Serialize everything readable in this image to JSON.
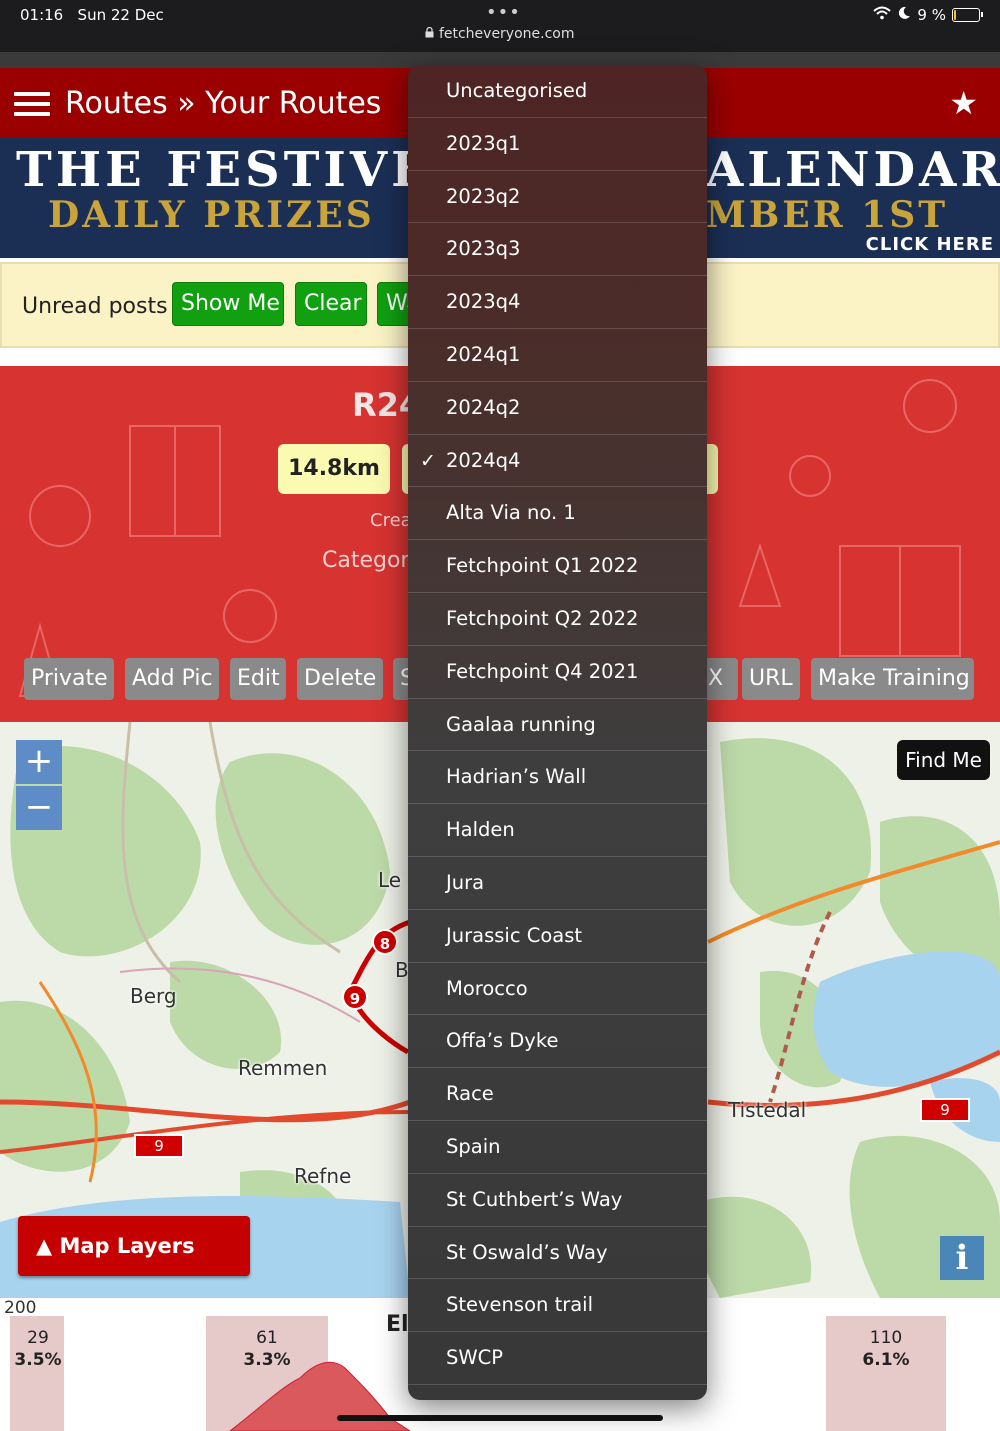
{
  "status_bar": {
    "time": "01:16",
    "date": "Sun 22 Dec",
    "dots": "•••",
    "url": "fetcheveryone.com",
    "battery": "9 %",
    "battery_level": 0.09,
    "wifi_icon": "wifi-icon",
    "moon_icon": "moon-icon"
  },
  "header": {
    "title": "Routes » Your Routes",
    "menu_icon": "hamburger-menu-icon",
    "star_icon": "star-icon"
  },
  "banner": {
    "line1_left": "THE FESTIVE",
    "line1_right": "ALENDAR",
    "line2_left": "DAILY PRIZES",
    "line2_right": "MBER 1ST",
    "click": "CLICK HERE"
  },
  "unread": {
    "label": "Unread posts",
    "show_me": "Show Me",
    "clear": "Clear",
    "third": "Wa"
  },
  "route": {
    "title": "R24",
    "distance": "14.8km",
    "created": "Crea",
    "category_label": "Categor",
    "actions": [
      "Private",
      "Add Pic",
      "Edit",
      "Delete",
      "S",
      "X",
      "URL",
      "Make Training"
    ]
  },
  "map": {
    "zoom_in": "+",
    "zoom_out": "−",
    "find_me": "Find Me",
    "map_layers": "▲ Map Layers",
    "info": "i",
    "places": [
      "Berg",
      "Remmen",
      "Refne",
      "Tistedal",
      "Le",
      "B"
    ],
    "road_number": "9",
    "waypoints": [
      "8",
      "9"
    ]
  },
  "elevation": {
    "axis_top": "200",
    "title": "El",
    "markers": [
      {
        "value": "29",
        "grade": "3.5%"
      },
      {
        "value": "61",
        "grade": "3.3%"
      },
      {
        "value": "110",
        "grade": "6.1%"
      }
    ]
  },
  "dropdown": {
    "selected": "2024q4",
    "items": [
      "Uncategorised",
      "2023q1",
      "2023q2",
      "2023q3",
      "2023q4",
      "2024q1",
      "2024q2",
      "2024q4",
      "Alta Via no. 1",
      "Fetchpoint Q1 2022",
      "Fetchpoint Q2 2022",
      "Fetchpoint Q4 2021",
      "Gaalaa running",
      "Hadrian’s Wall",
      "Halden",
      "Jura",
      "Jurassic Coast",
      "Morocco",
      "Offa’s Dyke",
      "Race",
      "Spain",
      "St Cuthbert’s Way",
      "St Oswald’s Way",
      "Stevenson trail",
      "SWCP"
    ],
    "check_icon": "checkmark-icon"
  },
  "colors": {
    "header_red": "#9b0000",
    "route_red": "#d63331",
    "green_button": "#10a010",
    "action_grey": "#8a8a8a",
    "zoom_blue": "#5d8cc6",
    "badge_yellow": "#fafab0"
  }
}
